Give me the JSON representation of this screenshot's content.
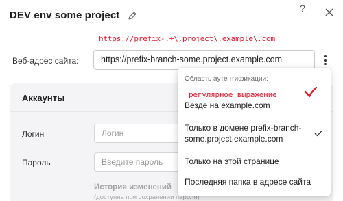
{
  "dialog": {
    "title": "DEV env some project",
    "help_label": "?",
    "icons": {
      "edit": "pencil-icon",
      "close": "close-icon",
      "more": "vertical-dots-icon",
      "check": "checkmark-icon"
    }
  },
  "annotations": {
    "url_regex": "https://prefix-.+\\.project\\.example\\.com",
    "dropdown_note": "регулярное выражение",
    "color": "#e0192b"
  },
  "site_url": {
    "label": "Веб-адрес сайта:",
    "value": "https://prefix-branch-some.project.example.com"
  },
  "accounts": {
    "title": "Аккаунты",
    "login_label": "Логин",
    "login_placeholder": "Логин",
    "password_label": "Пароль",
    "password_placeholder": "Введите пароль",
    "history_title": "История изменений",
    "history_note": "(доступна при сохранении пароля)"
  },
  "auth_scope": {
    "header": "Область аутентификации:",
    "selected_index": 1,
    "options": [
      {
        "line1": "Везде на example.com",
        "line2": ""
      },
      {
        "line1": "Только в домене prefix-branch-",
        "line2": "some.project.example.com"
      },
      {
        "line1": "Только на этой странице",
        "line2": ""
      },
      {
        "line1": "Последняя папка в адресе сайта",
        "line2": ""
      }
    ]
  }
}
